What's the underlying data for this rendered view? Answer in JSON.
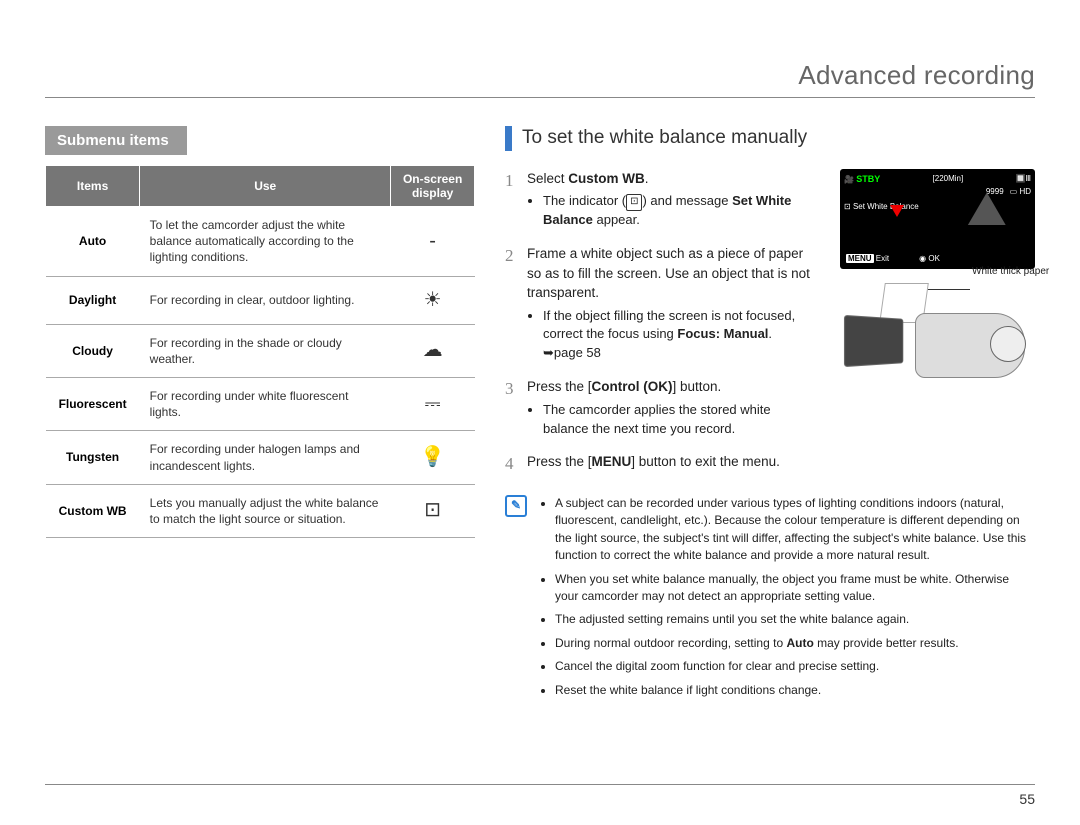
{
  "page": {
    "title": "Advanced recording",
    "number": "55"
  },
  "left": {
    "header": "Submenu items",
    "table": {
      "cols": {
        "items": "Items",
        "use": "Use",
        "display": "On-screen display"
      },
      "rows": [
        {
          "item": "Auto",
          "use": "To let the camcorder adjust the white balance automatically according to the lighting conditions.",
          "icon": "-"
        },
        {
          "item": "Daylight",
          "use": "For recording in clear, outdoor lighting.",
          "icon": "☀"
        },
        {
          "item": "Cloudy",
          "use": "For recording in the shade or cloudy weather.",
          "icon": "☁"
        },
        {
          "item": "Fluorescent",
          "use": "For recording under white fluorescent lights.",
          "icon": "⎓"
        },
        {
          "item": "Tungsten",
          "use": "For recording under halogen lamps and incandescent lights.",
          "icon": "💡"
        },
        {
          "item": "Custom WB",
          "use": "Lets you manually adjust the white balance to match the light source or situation.",
          "icon": "⊡"
        }
      ]
    }
  },
  "right": {
    "section_title": "To set the white balance manually",
    "diagram": {
      "lcd": {
        "stby": "STBY",
        "time": "[220Min]",
        "count": "9999",
        "hd": "HD",
        "set_wb": "Set White Balance",
        "menu": "MENU",
        "exit": "Exit",
        "ok": "OK"
      },
      "paper_label": "White thick paper"
    },
    "steps": [
      {
        "num": "1",
        "text": "Select ",
        "bold1": "Custom WB",
        "text2": ".",
        "bullets": [
          {
            "pre": "The indicator (",
            "icon": "⊡",
            "post": ") and message ",
            "bold": "Set White Balance",
            "tail": " appear."
          }
        ]
      },
      {
        "num": "2",
        "text": "Frame a white object such as a piece of paper so as to fill the screen. Use an object that is not transparent.",
        "bullets": [
          {
            "pre": "If the object filling the screen is not focused, correct the focus using ",
            "bold": "Focus: Manual",
            "tail": "."
          },
          {
            "pre": "➥page 58"
          }
        ]
      },
      {
        "num": "3",
        "text": "Press the [",
        "bold1": "Control (OK)",
        "text2": "] button.",
        "bullets": [
          {
            "pre": "The camcorder applies the stored white balance the next time you record."
          }
        ]
      },
      {
        "num": "4",
        "text": "Press the [",
        "bold1": "MENU",
        "text2": "] button to exit the menu."
      }
    ],
    "notes": [
      "A subject can be recorded under various types of lighting conditions indoors (natural, fluorescent, candlelight, etc.). Because the colour temperature is different depending on the light source, the subject's tint will differ, affecting the subject's white balance. Use this function to correct the white balance and provide a more natural result.",
      "When you set white balance manually, the object you frame must be white. Otherwise your camcorder may not detect an appropriate setting value.",
      "The adjusted setting remains until you set the white balance again.",
      "During normal outdoor recording, setting to Auto may provide better results.",
      "Cancel the digital zoom function for clear and precise setting.",
      "Reset the white balance if light conditions change."
    ],
    "notes_auto_bold": "Auto"
  }
}
